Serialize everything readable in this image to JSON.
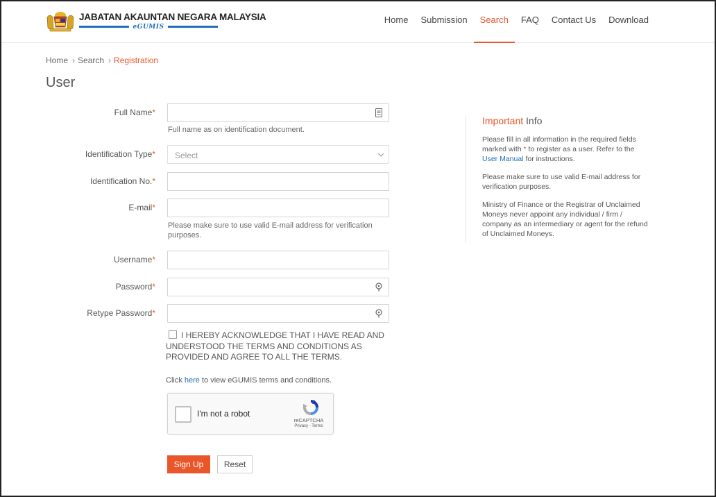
{
  "header": {
    "agency_title": "JABATAN AKAUNTAN NEGARA MALAYSIA",
    "system_name": "eGUMIS",
    "nav": [
      {
        "label": "Home",
        "active": false
      },
      {
        "label": "Submission",
        "active": false
      },
      {
        "label": "Search",
        "active": true
      },
      {
        "label": "FAQ",
        "active": false
      },
      {
        "label": "Contact Us",
        "active": false
      },
      {
        "label": "Download",
        "active": false
      }
    ]
  },
  "breadcrumb": {
    "items": [
      "Home",
      "Search"
    ],
    "current": "Registration",
    "separator": "›"
  },
  "page_title": "User",
  "form": {
    "required_mark": "*",
    "full_name": {
      "label": "Full Name",
      "value": "",
      "help": "Full name as on identification document."
    },
    "id_type": {
      "label": "Identification Type",
      "selected": "Select"
    },
    "id_no": {
      "label": "Identification No.",
      "value": ""
    },
    "email": {
      "label": "E-mail",
      "value": "",
      "help": "Please make sure to use valid E-mail address for verification purposes."
    },
    "username": {
      "label": "Username",
      "value": ""
    },
    "password": {
      "label": "Password",
      "value": ""
    },
    "retype_password": {
      "label": "Retype Password",
      "value": ""
    },
    "acknowledge": {
      "checked": false,
      "text": "I HEREBY ACKNOWLEDGE THAT I HAVE READ AND UNDERSTOOD THE TERMS AND CONDITIONS AS PROVIDED AND AGREE TO ALL THE TERMS."
    },
    "terms_prefix": "Click",
    "terms_link": "here",
    "terms_suffix": "to view eGUMIS terms and conditions.",
    "captcha": {
      "label": "I'm not a robot",
      "brand": "reCAPTCHA",
      "links": "Privacy - Terms",
      "checked": false
    },
    "signup_label": "Sign Up",
    "reset_label": "Reset"
  },
  "info": {
    "title_highlight": "Important",
    "title_rest": "Info",
    "p1_a": "Please fill in all information in the required fields marked with",
    "p1_mark": "*",
    "p1_b": "to register as a user. Refer to the",
    "p1_link": "User Manual",
    "p1_c": "for instructions.",
    "p2": "Please make sure to use valid E-mail address for verification purposes.",
    "p3": "Ministry of Finance or the Registrar of Unclaimed Moneys never appoint any individual / firm / company as an intermediary or agent for the refund of Unclaimed Moneys."
  },
  "colors": {
    "accent": "#e8562a",
    "link": "#1e6fb8"
  },
  "icons": {
    "full_name_suffix": "id-card-icon",
    "password_suffix": "key-icon",
    "select_arrow": "chevron-down-icon"
  }
}
